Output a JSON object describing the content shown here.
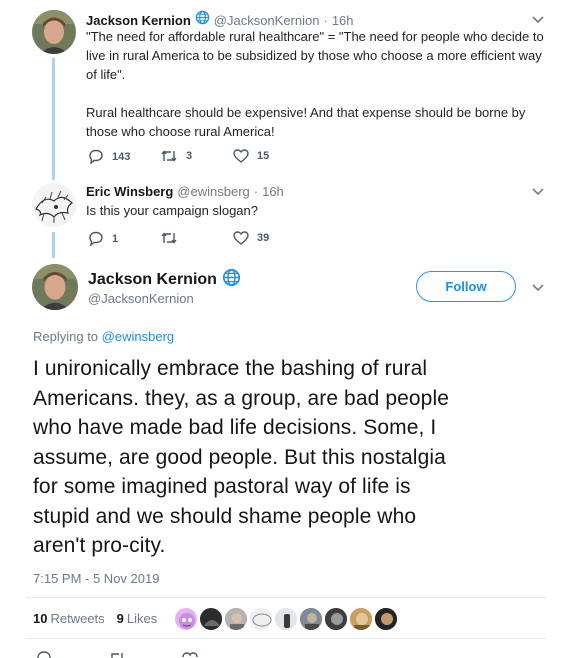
{
  "tweets": [
    {
      "name": "Jackson Kernion",
      "handle": "@JacksonKernion",
      "time": "16h",
      "text_lines": [
        "\"The need for affordable rural healthcare\" = \"The need for people who decide to",
        "live in rural America to be subsidized by those who choose a more efficient way",
        "of life\".",
        "",
        "Rural healthcare should be expensive! And that expense should be borne by",
        "those who choose rural America!"
      ],
      "replies": "143",
      "retweets": "3",
      "likes": "15"
    },
    {
      "name": "Eric Winsberg",
      "handle": "@ewinsberg",
      "time": "16h",
      "text_lines": [
        "Is this your campaign slogan?"
      ],
      "replies": "1",
      "retweets": "",
      "likes": "39"
    }
  ],
  "main": {
    "name": "Jackson Kernion",
    "handle": "@JacksonKernion",
    "follow_label": "Follow",
    "replying_prefix": "Replying to",
    "replying_to": "@ewinsberg",
    "text_lines": [
      "I unironically embrace the bashing of rural",
      "Americans. they, as a group, are bad people",
      "who have made bad life decisions. Some, I",
      "assume, are good people. But this nostalgia",
      "for some imagined pastoral way of life is",
      "stupid and we should shame people who",
      "aren't pro-city."
    ],
    "timestamp": "7:15 PM - 5 Nov 2019",
    "retweets_count": "10",
    "retweets_label": "Retweets",
    "likes_count": "9",
    "likes_label": "Likes"
  },
  "colors": {
    "accent": "#1b8fe6",
    "thread_line": "#a9d3f1",
    "muted_text": "#6b7b87"
  }
}
